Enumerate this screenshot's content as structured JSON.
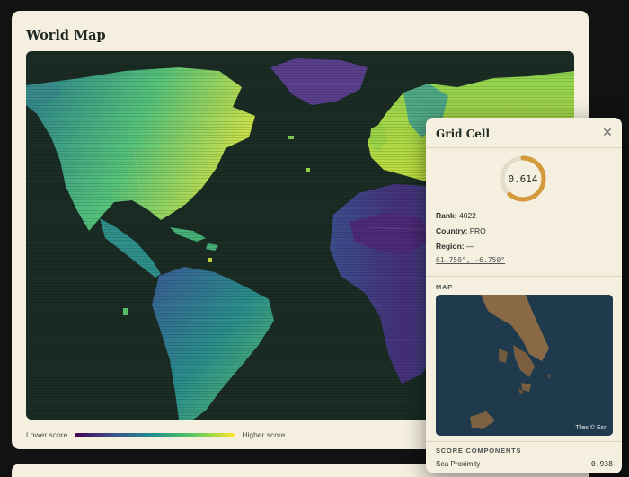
{
  "world_map": {
    "title": "World Map",
    "legend": {
      "low_label": "Lower score",
      "high_label": "Higher score"
    },
    "colors": {
      "ocean": "#1a2c24",
      "low": "#440154",
      "mid": "#21918c",
      "high": "#fde725"
    }
  },
  "grid_cell": {
    "title": "Grid Cell",
    "score": 0.614,
    "score_label": "0.614",
    "gauge_color": "#d39a3c",
    "rank_label": "Rank:",
    "rank": "4022",
    "country_label": "Country:",
    "country": "FRO",
    "region_label": "Region:",
    "region": "—",
    "coords": "61.750°, -6.750°",
    "map_section": "MAP",
    "tiles_credit": "Tiles © Esri",
    "score_section": "SCORE COMPONENTS",
    "components": [
      {
        "name": "Sea Proximity",
        "value": "0.938"
      }
    ]
  }
}
